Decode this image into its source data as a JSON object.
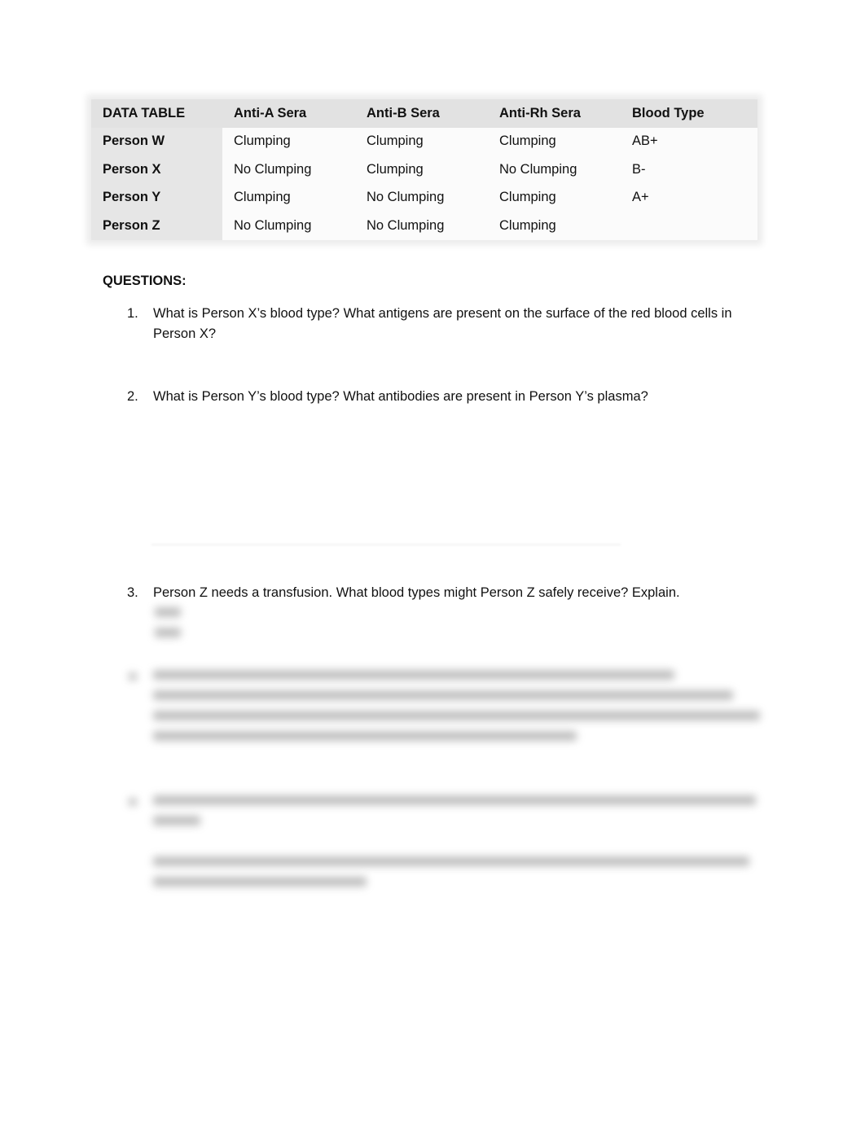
{
  "table": {
    "headers": [
      "DATA TABLE",
      "Anti-A Sera",
      "Anti-B Sera",
      "Anti-Rh Sera",
      "Blood Type"
    ],
    "rows": [
      {
        "person": "Person W",
        "anti_a": "Clumping",
        "anti_b": "Clumping",
        "anti_rh": "Clumping",
        "blood_type": "AB+"
      },
      {
        "person": "Person X",
        "anti_a": "No Clumping",
        "anti_b": "Clumping",
        "anti_rh": "No Clumping",
        "blood_type": "B-"
      },
      {
        "person": "Person Y",
        "anti_a": "Clumping",
        "anti_b": "No Clumping",
        "anti_rh": "Clumping",
        "blood_type": "A+"
      },
      {
        "person": "Person Z",
        "anti_a": "No Clumping",
        "anti_b": "No Clumping",
        "anti_rh": "Clumping",
        "blood_type": ""
      }
    ]
  },
  "questions": {
    "heading": "QUESTIONS:",
    "items": [
      {
        "number": "1.",
        "text": "What is Person X’s blood type? What antigens are present on the surface of the red blood cells in Person X?"
      },
      {
        "number": "2.",
        "text": "What is Person Y’s blood type? What antibodies are present in Person Y’s plasma?"
      },
      {
        "number": "3.",
        "text": "Person Z needs a transfusion. What blood types might Person Z safely receive? Explain."
      }
    ]
  }
}
